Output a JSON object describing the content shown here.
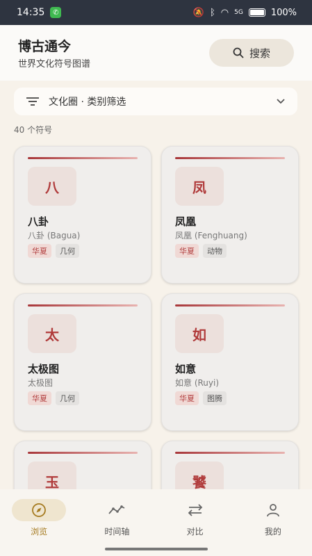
{
  "status": {
    "time": "14:35",
    "battery": "100%",
    "signal_label": "5G"
  },
  "header": {
    "title": "博古通今",
    "subtitle": "世界文化符号图谱",
    "search_label": "搜索"
  },
  "filter": {
    "label": "文化圈 · 类别筛选"
  },
  "count_label": "40 个符号",
  "cards": [
    {
      "glyph": "八",
      "name": "八卦",
      "subname": "八卦 (Bagua)",
      "tags": [
        "华夏",
        "几何"
      ]
    },
    {
      "glyph": "凤",
      "name": "凤凰",
      "subname": "凤凰 (Fenghuang)",
      "tags": [
        "华夏",
        "动物"
      ]
    },
    {
      "glyph": "太",
      "name": "太极图",
      "subname": "太极图",
      "tags": [
        "华夏",
        "几何"
      ]
    },
    {
      "glyph": "如",
      "name": "如意",
      "subname": "如意 (Ruyi)",
      "tags": [
        "华夏",
        "图腾"
      ]
    },
    {
      "glyph": "玉",
      "name": "",
      "subname": "",
      "tags": []
    },
    {
      "glyph": "饕",
      "name": "",
      "subname": "",
      "tags": []
    }
  ],
  "nav": [
    {
      "label": "浏览",
      "icon": "compass-icon",
      "active": true
    },
    {
      "label": "时间轴",
      "icon": "timeline-icon",
      "active": false
    },
    {
      "label": "对比",
      "icon": "compare-icon",
      "active": false
    },
    {
      "label": "我的",
      "icon": "person-icon",
      "active": false
    }
  ]
}
